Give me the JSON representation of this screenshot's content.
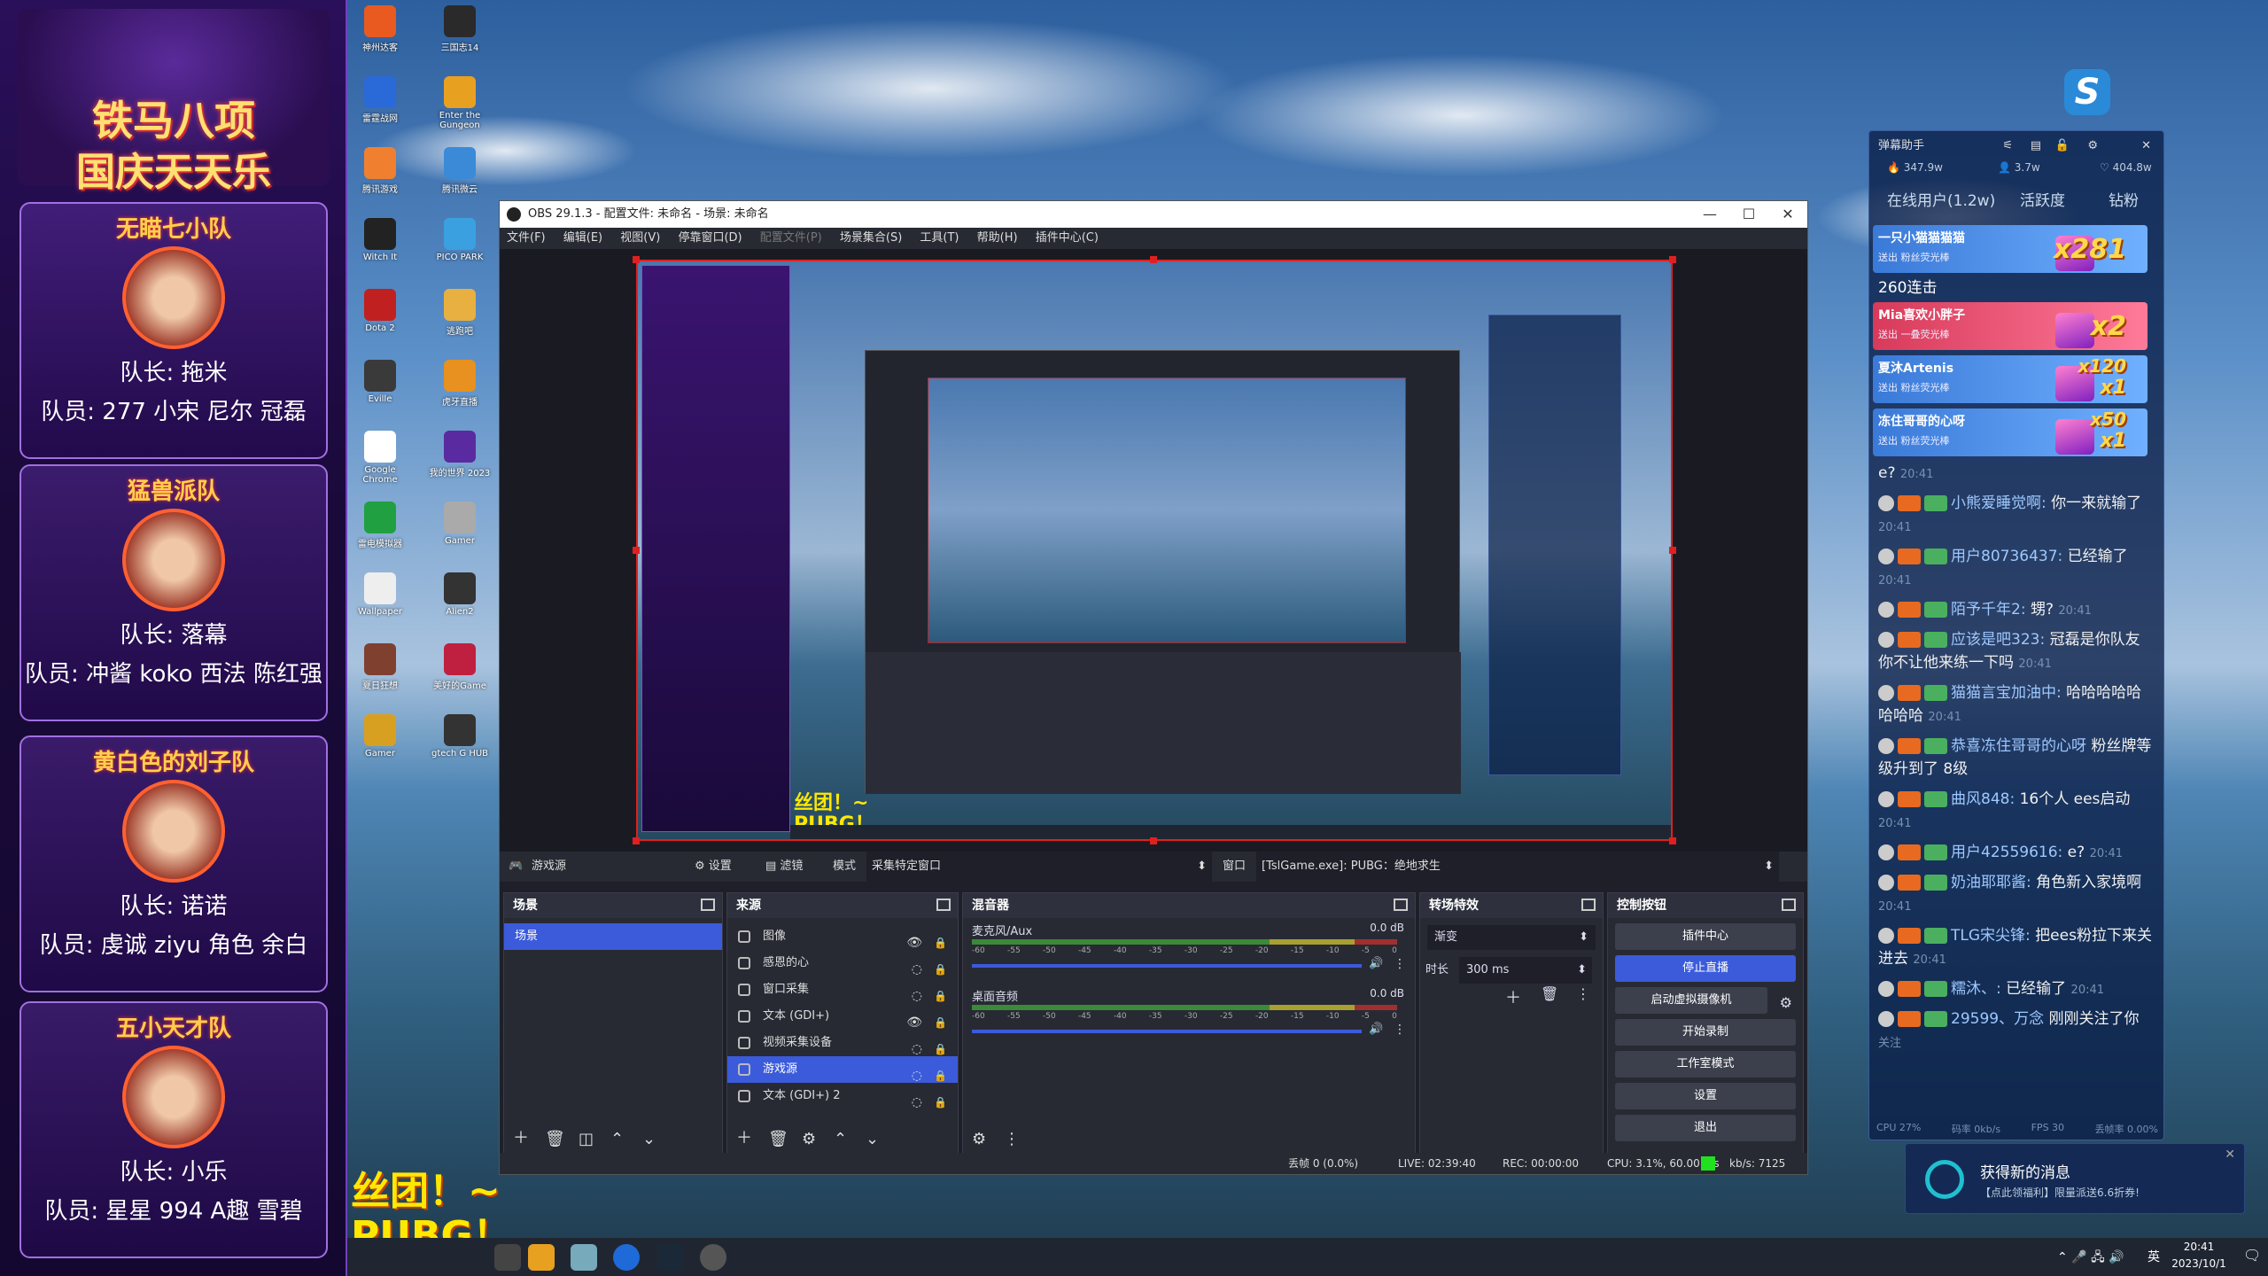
{
  "left_overlay": {
    "banner_title": "铁马八项",
    "banner_subtitle": "国庆天天乐",
    "teams": [
      {
        "name": "无瞄七小队",
        "captain": "队长: 拖米",
        "members": "队员: 277  小宋  尼尔 冠磊"
      },
      {
        "name": "猛兽派队",
        "captain": "队长: 落幕",
        "members": "队员: 冲酱 koko 西法 陈红强"
      },
      {
        "name": "黄白色的刘子队",
        "captain": "队长: 诺诺",
        "members": "队员: 虔诚  ziyu  角色 余白"
      },
      {
        "name": "五小天才队",
        "captain": "队长: 小乐",
        "members": "队员: 星星  994   A趣  雪碧"
      }
    ]
  },
  "desktop_icons": [
    {
      "label": "神州达客"
    },
    {
      "label": "三国志14"
    },
    {
      "label": "雷霆战网"
    },
    {
      "label": "Enter the Gungeon"
    },
    {
      "label": "腾讯游戏"
    },
    {
      "label": "腾讯微云"
    },
    {
      "label": "Witch It"
    },
    {
      "label": "PICO PARK"
    },
    {
      "label": "Dota 2"
    },
    {
      "label": "逃跑吧"
    },
    {
      "label": "Eville"
    },
    {
      "label": "虎牙直播"
    },
    {
      "label": "Google Chrome"
    },
    {
      "label": "我的世界 2023"
    },
    {
      "label": "雷电模拟器"
    },
    {
      "label": "Gamer"
    },
    {
      "label": "Wallpaper"
    },
    {
      "label": "Alien2"
    },
    {
      "label": "夏日狂想"
    },
    {
      "label": "美好的Game"
    },
    {
      "label": "Gamer"
    },
    {
      "label": "gtech G HUB"
    }
  ],
  "obs": {
    "title": "OBS 29.1.3 - 配置文件: 未命名 - 场景: 未命名",
    "menu": [
      "文件(F)",
      "编辑(E)",
      "视图(V)",
      "停靠窗口(D)",
      "配置文件(P)",
      "场景集合(S)",
      "工具(T)",
      "帮助(H)",
      "插件中心(C)"
    ],
    "source_bar": {
      "source": "游戏源",
      "settings": "设置",
      "filters": "滤镜",
      "mode_label": "模式",
      "mode_value": "采集特定窗口",
      "window_label": "窗口",
      "window_value": "[TslGame.exe]: PUBG：绝地求生"
    },
    "scenes": {
      "title": "场景",
      "items": [
        "场景"
      ]
    },
    "sources": {
      "title": "来源",
      "items": [
        {
          "label": "图像",
          "visible": true
        },
        {
          "label": "感恩的心",
          "visible": false
        },
        {
          "label": "窗口采集",
          "visible": false
        },
        {
          "label": "文本 (GDI+)",
          "visible": true
        },
        {
          "label": "视频采集设备",
          "visible": false
        },
        {
          "label": "游戏源",
          "visible": false,
          "selected": true
        },
        {
          "label": "文本 (GDI+) 2",
          "visible": false
        }
      ]
    },
    "mixer": {
      "title": "混音器",
      "tracks": [
        {
          "name": "麦克风/Aux",
          "db": "0.0 dB"
        },
        {
          "name": "桌面音频",
          "db": "0.0 dB"
        }
      ],
      "ticks": [
        "-60",
        "-55",
        "-50",
        "-45",
        "-40",
        "-35",
        "-30",
        "-25",
        "-20",
        "-15",
        "-10",
        "-5",
        "0"
      ]
    },
    "transitions": {
      "title": "转场特效",
      "type": "渐变",
      "duration_label": "时长",
      "duration_value": "300 ms"
    },
    "controls": {
      "title": "控制按钮",
      "buttons": [
        "插件中心",
        "停止直播",
        "启动虚拟摄像机",
        "开始录制",
        "工作室模式",
        "设置",
        "退出"
      ]
    },
    "status": {
      "dropped": "丢帧 0 (0.0%)",
      "live": "LIVE: 02:39:40",
      "rec": "REC: 00:00:00",
      "cpu": "CPU: 3.1%, 60.00 fps",
      "kbs": "kb/s: 7125"
    }
  },
  "chat": {
    "title": "弹幕助手",
    "stats": [
      "347.9w",
      "3.7w",
      "404.8w"
    ],
    "tabs": [
      "在线用户(1.2w)",
      "活跃度",
      "钻粉"
    ],
    "gifts": [
      {
        "name": "一只小猫猫猫猫",
        "sub": "送出   粉丝荧光棒",
        "count": "x281",
        "extra": "260连击"
      },
      {
        "name": "Mia喜欢小胖子",
        "sub": "送出   一叠荧光棒",
        "count": "x2"
      },
      {
        "name": "夏沐Artenis",
        "sub": "送出   粉丝荧光棒",
        "count": "x1",
        "combo": "x120"
      },
      {
        "name": "冻住哥哥的心呀",
        "sub": "送出   粉丝荧光棒",
        "count": "x1",
        "combo": "x50"
      }
    ],
    "messages": [
      {
        "user": "",
        "text": "e?",
        "time": "20:41"
      },
      {
        "user": "小熊爱睡觉啊:",
        "text": " 你一来就输了",
        "time": "20:41"
      },
      {
        "user": "用户80736437:",
        "text": " 已经输了",
        "time": "20:41"
      },
      {
        "user": "陌予千年2:",
        "text": " 甥?",
        "time": "20:41"
      },
      {
        "user": "应该是吧323:",
        "text": " 冠磊是你队友你不让他来练一下吗",
        "time": "20:41"
      },
      {
        "user": "猫猫言宝加油中:",
        "text": " 哈哈哈哈哈哈哈哈",
        "time": "20:41"
      },
      {
        "user": "恭喜冻住哥哥的心呀",
        "text": " 粉丝牌等级升到了 8级",
        "time": ""
      },
      {
        "user": "曲风848:",
        "text": " 16个人 ees启动",
        "time": "20:41"
      },
      {
        "user": "用户42559616:",
        "text": " e?",
        "time": "20:41"
      },
      {
        "user": "奶油耶耶酱:",
        "text": " 角色新入家境啊",
        "time": "20:41"
      },
      {
        "user": "TLG宋尖锋:",
        "text": " 把ees粉拉下来关进去",
        "time": "20:41"
      },
      {
        "user": "糯沐、:",
        "text": " 已经输了",
        "time": "20:41"
      },
      {
        "user": "29599、万念",
        "text": " 刚刚关注了你",
        "time": "关注"
      }
    ],
    "footer": [
      "CPU 27%",
      "码率 0kb/s",
      "FPS 30",
      "丢帧率 0.00%"
    ]
  },
  "toast": {
    "title": "获得新的消息",
    "body": "【点此领福利】限量派送6.6折券!"
  },
  "overlay_text": {
    "line1": "丝团！~",
    "line2": "PUBG！"
  },
  "tray": {
    "ime": "英",
    "time": "20:41",
    "date": "2023/10/1"
  },
  "colors": {
    "accent": "#3b5bdb",
    "preview_border": "#e02020",
    "gold": "#ffd84a"
  }
}
